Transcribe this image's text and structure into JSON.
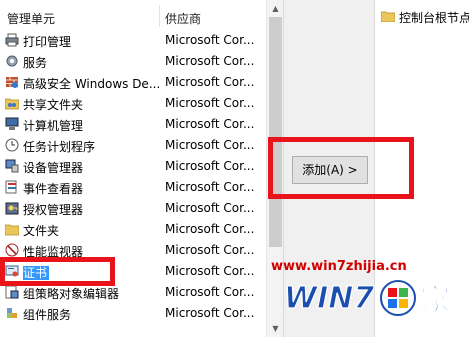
{
  "snapin_list": {
    "headers": {
      "name": "管理单元",
      "vendor": "供应商"
    },
    "rows": [
      {
        "name": "打印管理",
        "vendor": "Microsoft Cor...",
        "icon": "printer-icon"
      },
      {
        "name": "服务",
        "vendor": "Microsoft Cor...",
        "icon": "gear-icon"
      },
      {
        "name": "高级安全 Windows De...",
        "vendor": "Microsoft Cor...",
        "icon": "firewall-icon"
      },
      {
        "name": "共享文件夹",
        "vendor": "Microsoft Cor...",
        "icon": "shared-folder-icon"
      },
      {
        "name": "计算机管理",
        "vendor": "Microsoft Cor...",
        "icon": "computer-management-icon"
      },
      {
        "name": "任务计划程序",
        "vendor": "Microsoft Cor...",
        "icon": "clock-icon"
      },
      {
        "name": "设备管理器",
        "vendor": "Microsoft Cor...",
        "icon": "device-manager-icon"
      },
      {
        "name": "事件查看器",
        "vendor": "Microsoft Cor...",
        "icon": "event-viewer-icon"
      },
      {
        "name": "授权管理器",
        "vendor": "Microsoft Cor...",
        "icon": "authorization-icon"
      },
      {
        "name": "文件夹",
        "vendor": "Microsoft Cor...",
        "icon": "folder-icon"
      },
      {
        "name": "性能监视器",
        "vendor": "Microsoft Cor...",
        "icon": "performance-icon"
      },
      {
        "name": "证书",
        "vendor": "Microsoft Cor...",
        "icon": "certificate-icon",
        "selected": true
      },
      {
        "name": "组策略对象编辑器",
        "vendor": "Microsoft Cor...",
        "icon": "group-policy-icon"
      },
      {
        "name": "组件服务",
        "vendor": "Microsoft Cor...",
        "icon": "component-services-icon"
      }
    ]
  },
  "add_button": {
    "label": "添加(A) >"
  },
  "selected_snapins": {
    "items": [
      {
        "label": "控制台根节点",
        "icon": "folder-icon"
      }
    ]
  },
  "watermark": {
    "url": "www.win7zhijia.cn",
    "logo_text": "WIN7之家"
  },
  "colors": {
    "highlight": "#e8141a",
    "selection": "#3399ff"
  }
}
